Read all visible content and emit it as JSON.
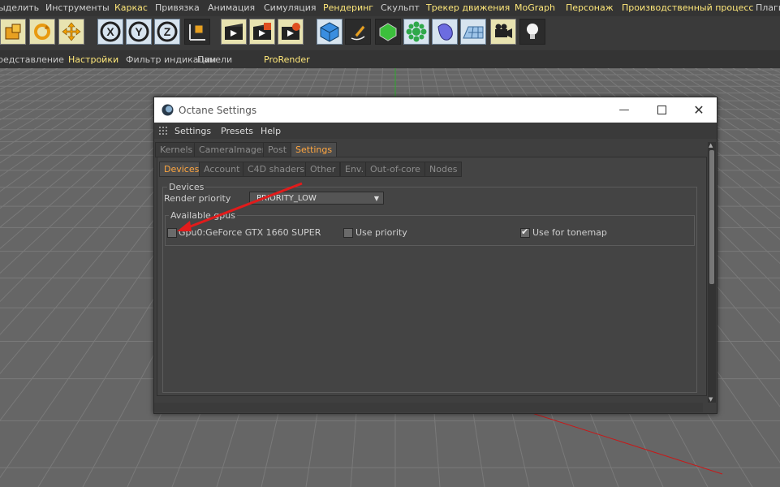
{
  "menubar": {
    "items": [
      {
        "label": "ыделить",
        "hl": false
      },
      {
        "label": "Инструменты",
        "hl": false
      },
      {
        "label": "Каркас",
        "hl": true
      },
      {
        "label": "Привязка",
        "hl": false
      },
      {
        "label": "Анимация",
        "hl": false
      },
      {
        "label": "Симуляция",
        "hl": false
      },
      {
        "label": "Рендеринг",
        "hl": true
      },
      {
        "label": "Скульпт",
        "hl": false
      },
      {
        "label": "Трекер движения",
        "hl": true
      },
      {
        "label": "MoGraph",
        "hl": true
      },
      {
        "label": "Персонаж",
        "hl": true
      },
      {
        "label": "Производственный процесс",
        "hl": true
      },
      {
        "label": "Плаги",
        "hl": false
      }
    ]
  },
  "toolbar": {
    "icons": [
      "scale-icon",
      "rotate-icon",
      "move-icon",
      "x-axis-icon",
      "y-axis-icon",
      "z-axis-icon",
      "coordinate-system-icon",
      "render-view-icon",
      "render-picture-viewer-icon",
      "render-settings-icon",
      "cube-icon",
      "pen-icon",
      "subdivision-icon",
      "cloner-icon",
      "deformer-icon",
      "floor-icon",
      "camera-icon",
      "light-icon"
    ],
    "axis_labels": [
      "X",
      "Y",
      "Z"
    ]
  },
  "submenu": {
    "items": [
      {
        "label": "редставление",
        "hl": false
      },
      {
        "label": "Настройки",
        "hl": true
      },
      {
        "label": "Фильтр индикации",
        "hl": false
      },
      {
        "label": "Панели",
        "hl": false
      },
      {
        "label": "ProRender",
        "hl": true
      }
    ]
  },
  "dialog": {
    "title": "Octane Settings",
    "menu": [
      "Settings",
      "Presets",
      "Help"
    ],
    "tabs_top": [
      {
        "label": "Kernels",
        "active": false
      },
      {
        "label": "CameraImager",
        "active": false
      },
      {
        "label": "Post",
        "active": false
      },
      {
        "label": "Settings",
        "active": true
      }
    ],
    "tabs_sub": [
      {
        "label": "Devices",
        "active": true
      },
      {
        "label": "Account",
        "active": false
      },
      {
        "label": "C4D shaders",
        "active": false
      },
      {
        "label": "Other",
        "active": false
      },
      {
        "label": "Env.",
        "active": false
      },
      {
        "label": "Out-of-core",
        "active": false
      },
      {
        "label": "Nodes",
        "active": false
      }
    ],
    "devices_group_label": "Devices",
    "render_priority_label": "Render priority",
    "render_priority_value": "PRIORITY_LOW",
    "available_gpus_label": "Available gpus",
    "gpu": {
      "name": "Gpu0:GeForce GTX 1660 SUPER",
      "enabled": false
    },
    "use_priority": {
      "label": "Use priority",
      "checked": false
    },
    "use_for_tonemap": {
      "label": "Use for tonemap",
      "checked": true
    }
  },
  "colors": {
    "accent": "#ffa640",
    "menu_highlight": "#ffe87a",
    "annotation_arrow": "#e11b1b",
    "axis_x": "#c81818",
    "axis_y": "#2eaa2e"
  }
}
